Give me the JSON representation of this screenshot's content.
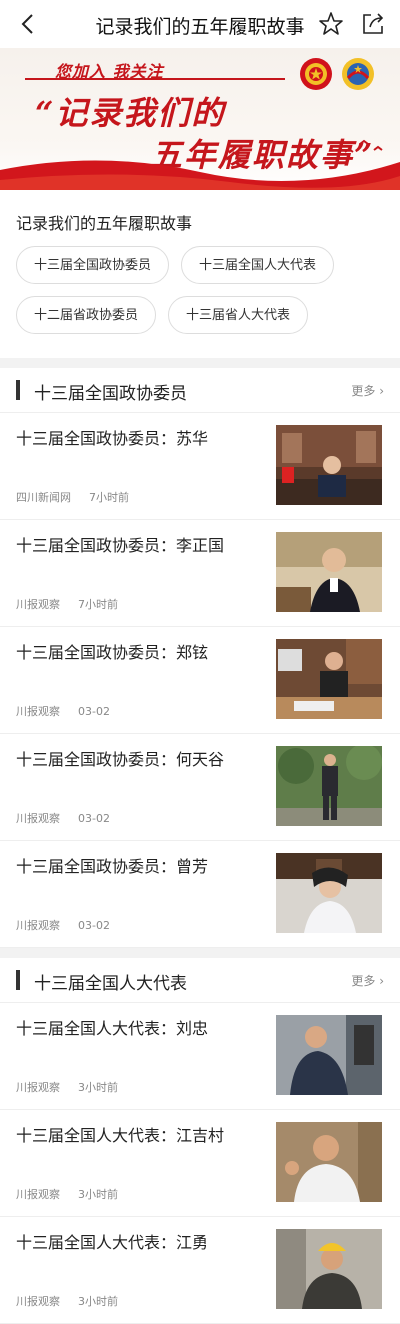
{
  "header": {
    "title": "记录我们的五年履职故事",
    "back_icon": "chevron-left-icon",
    "star_icon": "star-icon",
    "share_icon": "share-icon"
  },
  "banner": {
    "slogan": "您加入 我关注",
    "headline_1": "“记录我们的",
    "headline_2": "五年履职故事”",
    "accent_color": "#c5161c"
  },
  "intro": {
    "heading": "记录我们的五年履职故事",
    "chips": [
      "十三届全国政协委员",
      "十三届全国人大代表",
      "十二届省政协委员",
      "十三届省人大代表"
    ]
  },
  "sections": [
    {
      "title": "十三届全国政协委员",
      "more": "更多",
      "items": [
        {
          "title": "十三届全国政协委员：苏华",
          "source": "四川新闻网",
          "time": "7小时前"
        },
        {
          "title": "十三届全国政协委员：李正国",
          "source": "川报观察",
          "time": "7小时前"
        },
        {
          "title": "十三届全国政协委员：郑铉",
          "source": "川报观察",
          "time": "03-02"
        },
        {
          "title": "十三届全国政协委员：何天谷",
          "source": "川报观察",
          "time": "03-02"
        },
        {
          "title": "十三届全国政协委员：曾芳",
          "source": "川报观察",
          "time": "03-02"
        }
      ]
    },
    {
      "title": "十三届全国人大代表",
      "more": "更多",
      "items": [
        {
          "title": "十三届全国人大代表：刘忠",
          "source": "川报观察",
          "time": "3小时前"
        },
        {
          "title": "十三届全国人大代表：江吉村",
          "source": "川报观察",
          "time": "3小时前"
        },
        {
          "title": "十三届全国人大代表：江勇",
          "source": "川报观察",
          "time": "3小时前"
        }
      ]
    }
  ]
}
